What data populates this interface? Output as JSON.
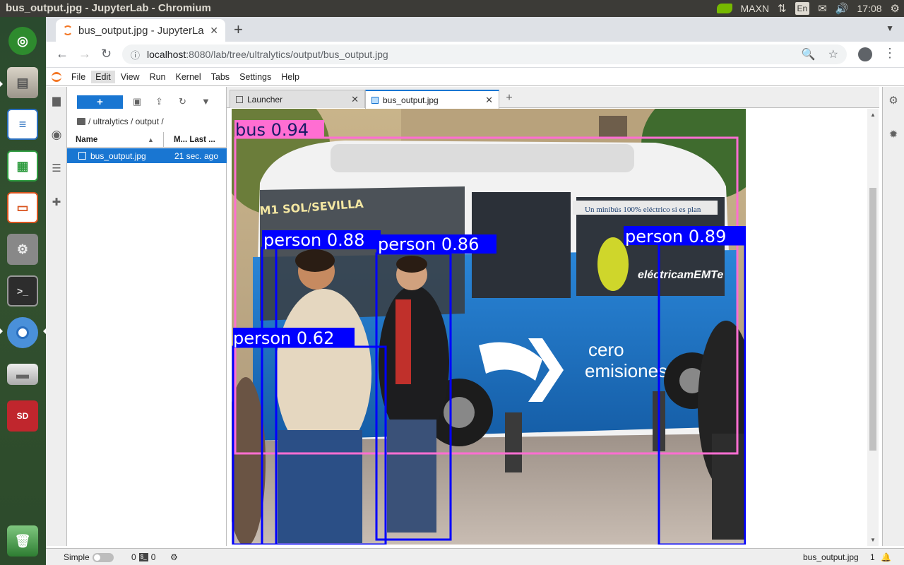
{
  "top_panel": {
    "window_title": "bus_output.jpg - JupyterLab - Chromium",
    "power_mode": "MAXN",
    "language": "En",
    "clock": "17:08"
  },
  "dock": {
    "items": [
      "ubuntu-dash",
      "file-manager",
      "writer",
      "calc",
      "impress",
      "system-settings",
      "terminal",
      "chromium",
      "removable-drive",
      "sd-card",
      "trash"
    ],
    "sd_label": "SD"
  },
  "browser": {
    "tab_title": "bus_output.jpg - JupyterLab",
    "url_host": "localhost",
    "url_path": ":8080/lab/tree/ultralytics/output/bus_output.jpg"
  },
  "jupyter": {
    "menu": [
      "File",
      "Edit",
      "View",
      "Run",
      "Kernel",
      "Tabs",
      "Settings",
      "Help"
    ],
    "active_menu": "Edit",
    "new_button": "+",
    "breadcrumb": "/ ultralytics / output /",
    "columns": {
      "name": "Name",
      "modified": "M... Last ..."
    },
    "files": [
      {
        "name": "bus_output.jpg",
        "modified": "21 sec. ago"
      }
    ],
    "tabs": [
      {
        "label": "Launcher",
        "active": false
      },
      {
        "label": "bus_output.jpg",
        "active": true
      }
    ],
    "status": {
      "mode": "Simple",
      "kernels": "0",
      "terminals": "0",
      "document": "bus_output.jpg",
      "line": "1"
    }
  },
  "detections": [
    {
      "label": "bus 0.94",
      "color": "#ff6ed2"
    },
    {
      "label": "person 0.88",
      "color": "#0000ff"
    },
    {
      "label": "person 0.86",
      "color": "#0000ff"
    },
    {
      "label": "person 0.89",
      "color": "#0000ff"
    },
    {
      "label": "person 0.62",
      "color": "#0000ff"
    }
  ],
  "image_text": {
    "route_sign": "M1 SOL/SEVILLA",
    "side_slogan": "Un minibús 100% eléctrico si es plan",
    "brand": "eléctricamEMTe",
    "emission_line1": "cero",
    "emission_line2": "emisiones"
  },
  "colors": {
    "accent": "#1976d2",
    "jupyter_orange": "#f37726",
    "bus_blue": "#1a6fc0",
    "bus_box": "#ff6ed2",
    "person_box": "#0000ff"
  }
}
